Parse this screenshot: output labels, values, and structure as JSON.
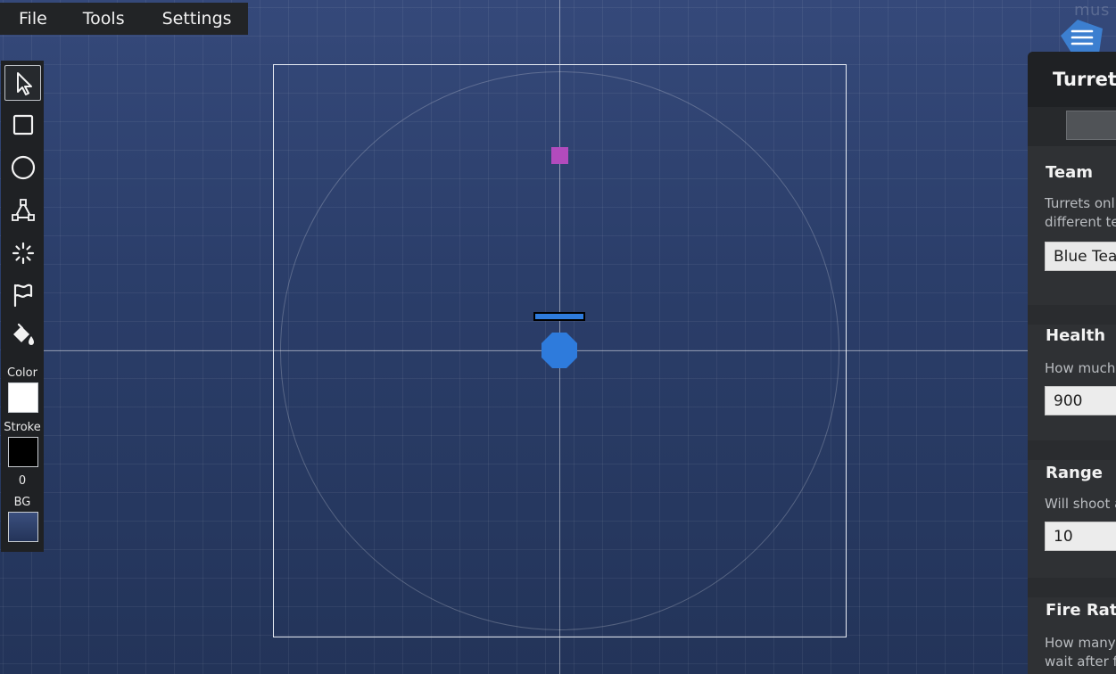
{
  "menubar": {
    "items": [
      "File",
      "Tools",
      "Settings"
    ]
  },
  "toolbar": {
    "tools": [
      {
        "name": "select-tool",
        "icon": "cursor-arrow-icon"
      },
      {
        "name": "rectangle-tool",
        "icon": "square-icon"
      },
      {
        "name": "circle-tool",
        "icon": "circle-icon"
      },
      {
        "name": "polygon-tool",
        "icon": "polygon-icon"
      },
      {
        "name": "spawner-tool",
        "icon": "sparkle-icon"
      },
      {
        "name": "flag-tool",
        "icon": "flag-icon"
      },
      {
        "name": "fill-tool",
        "icon": "paint-bucket-icon"
      }
    ],
    "active_tool": "select-tool",
    "color_label": "Color",
    "color_value": "#ffffff",
    "stroke_label": "Stroke",
    "stroke_color": "#000000",
    "stroke_width": "0",
    "bg_label": "BG",
    "bg_color": "#2f4068"
  },
  "corner_text": "mus",
  "canvas": {
    "background": "#2b3e6a",
    "turret_color": "#2e7bdc",
    "target_color": "#b24bbd",
    "health_fill": 1.0
  },
  "panel": {
    "title": "Turret",
    "sections": {
      "team": {
        "title": "Team",
        "desc_lines": [
          "Turrets onl",
          "different te"
        ],
        "value": "Blue Tea"
      },
      "health": {
        "title": "Health",
        "desc_lines": [
          "How much"
        ],
        "value": "900"
      },
      "range": {
        "title": "Range",
        "desc_lines": [
          "Will shoot a"
        ],
        "value": "10"
      },
      "fire_rate": {
        "title": "Fire Rate",
        "desc_lines": [
          "How many",
          "wait after f"
        ]
      }
    }
  }
}
